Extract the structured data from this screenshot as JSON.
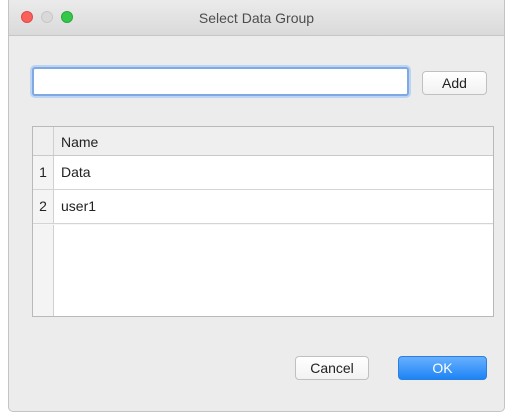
{
  "window": {
    "title": "Select Data Group"
  },
  "input": {
    "value": "",
    "placeholder": ""
  },
  "buttons": {
    "add": "Add",
    "cancel": "Cancel",
    "ok": "OK"
  },
  "table": {
    "columns": [
      "Name"
    ],
    "rows": [
      {
        "index": "1",
        "name": "Data"
      },
      {
        "index": "2",
        "name": "user1"
      }
    ]
  },
  "colors": {
    "ok_button": "#1d84f5",
    "focus_ring": "#7fa9e2",
    "close_light": "#fc605b",
    "zoom_light": "#34c84a"
  }
}
